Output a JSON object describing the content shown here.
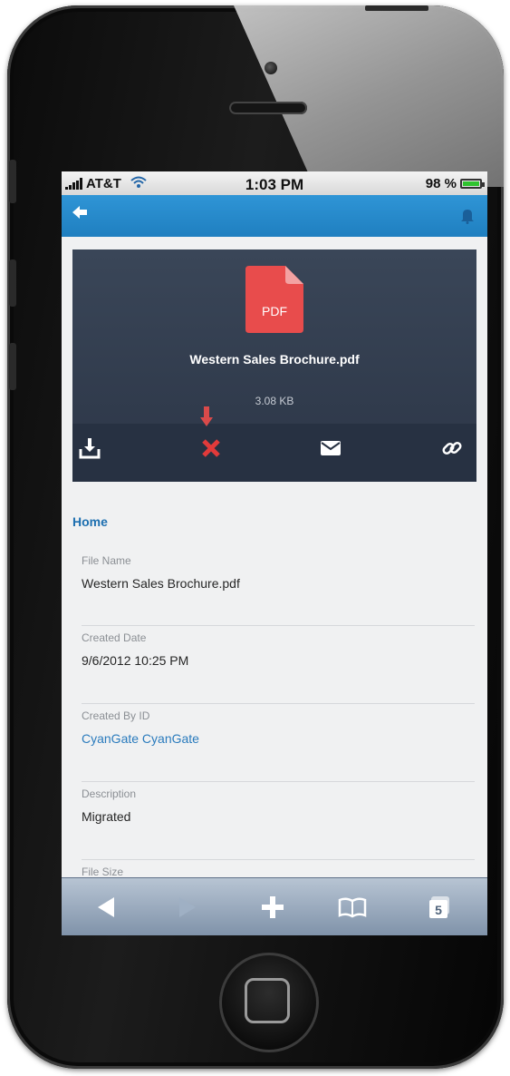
{
  "status_bar": {
    "carrier": "AT&T",
    "time": "1:03 PM",
    "battery": "98 %",
    "battery_fraction": 0.98
  },
  "nav_bar": {
    "back_icon": "back-arrow-icon",
    "right_icon": "bell-icon"
  },
  "file": {
    "type_label": "PDF",
    "name": "Western Sales Brochure.pdf",
    "size": "3.08 KB",
    "actions": [
      "download-icon",
      "delete-icon",
      "email-icon",
      "link-icon"
    ]
  },
  "details": {
    "section_title": "Home",
    "fields": [
      {
        "label": "File Name",
        "value": "Western Sales Brochure.pdf"
      },
      {
        "label": "Created Date",
        "value": "9/6/2012 10:25 PM"
      },
      {
        "label": "Created By ID",
        "value": "CyanGate CyanGate"
      },
      {
        "label": "Description",
        "value": "Migrated"
      },
      {
        "label": "File Size"
      }
    ]
  },
  "browser_toolbar": {
    "tabs_count": "5",
    "icons": [
      "back-icon",
      "forward-icon",
      "add-icon",
      "bookmarks-icon",
      "tabs-icon"
    ]
  },
  "colors": {
    "nav_blue": "#1f7fc0",
    "card_dark": "#2c3647",
    "pdf_red": "#e84c4c",
    "link_blue": "#2a7bbd",
    "delete_red": "#e23a3a"
  }
}
